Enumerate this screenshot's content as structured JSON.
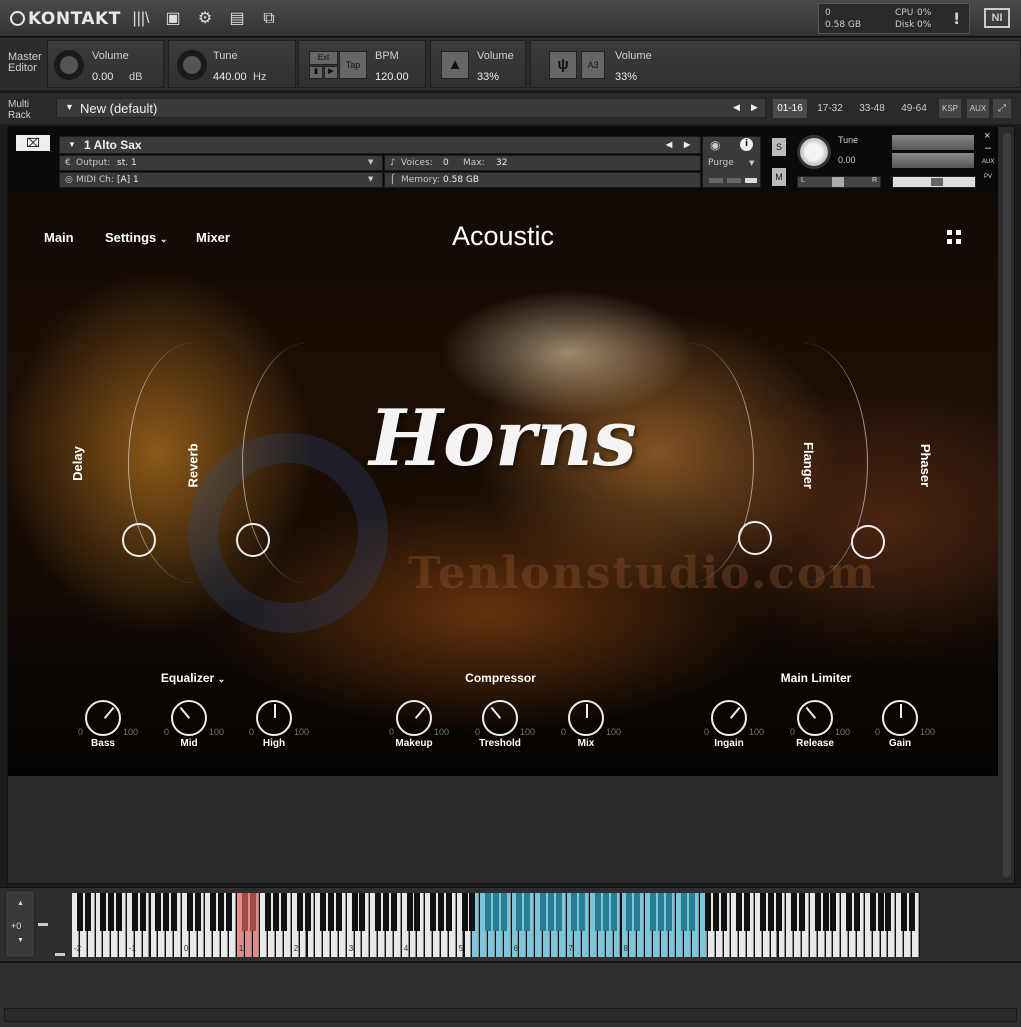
{
  "topbar": {
    "logo": "KONTAKT",
    "voices_label": "0",
    "mem_label": "0.58 GB",
    "cpu_label": "CPU",
    "cpu_val": "0%",
    "disk_label": "Disk",
    "disk_val": "0%",
    "alert": "!",
    "ni": "NI"
  },
  "master": {
    "label_line1": "Master",
    "label_line2": "Editor",
    "volume_label": "Volume",
    "volume_value": "0.00",
    "volume_unit": "dB",
    "tune_label": "Tune",
    "tune_value": "440.00",
    "tune_unit": "Hz",
    "ext_label": "Ext",
    "tap_label": "Tap",
    "bpm_label": "BPM",
    "bpm_value": "120.00",
    "metro_label": "Volume",
    "metro_value": "33%",
    "ref_note": "A3",
    "ref_label": "Volume",
    "ref_value": "33%"
  },
  "rack": {
    "label_line1": "Multi",
    "label_line2": "Rack",
    "preset": "New (default)",
    "pages": [
      "01-16",
      "17-32",
      "33-48",
      "49-64"
    ],
    "ksp": "KSP",
    "aux": "AUX"
  },
  "instrument": {
    "name": "1 Alto Sax",
    "output_label": "Output:",
    "output_value": "st. 1",
    "voices_label": "Voices:",
    "voices_value": "0",
    "max_label": "Max:",
    "max_value": "32",
    "midi_label": "MIDI Ch:",
    "midi_value": "[A]  1",
    "memory_label": "Memory:",
    "memory_value": "0.58 GB",
    "purge": "Purge",
    "solo": "S",
    "mute": "M",
    "tune_label": "Tune",
    "tune_value": "0.00",
    "pan_l": "L",
    "pan_r": "R",
    "aux": "AUX",
    "pv": "PV"
  },
  "gui": {
    "nav": [
      "Main",
      "Settings",
      "Mixer"
    ],
    "title": "Acoustic",
    "logo_text": "Horns",
    "watermark": "Tenlonstudio.com",
    "fx": [
      "Delay",
      "Reverb",
      "Flanger",
      "Phaser"
    ],
    "eq_title": "Equalizer",
    "comp_title": "Compressor",
    "lim_title": "Main Limiter",
    "knobs": [
      {
        "label": "Bass",
        "min": "0",
        "max": "100"
      },
      {
        "label": "Mid",
        "min": "0",
        "max": "100"
      },
      {
        "label": "High",
        "min": "0",
        "max": "100"
      },
      {
        "label": "Makeup",
        "min": "0",
        "max": "100"
      },
      {
        "label": "Treshold",
        "min": "0",
        "max": "100"
      },
      {
        "label": "Mix",
        "min": "0",
        "max": "100"
      },
      {
        "label": "Ingain",
        "min": "0",
        "max": "100"
      },
      {
        "label": "Release",
        "min": "0",
        "max": "100"
      },
      {
        "label": "Gain",
        "min": "0",
        "max": "100"
      }
    ]
  },
  "keyboard": {
    "transpose": "+0",
    "octaves": [
      "-2",
      "-1",
      "0",
      "1",
      "2",
      "3",
      "4",
      "5",
      "6",
      "7",
      "8"
    ]
  },
  "colors": {
    "keyswitch": "#e08a8a",
    "range": "#7cc6dc"
  }
}
